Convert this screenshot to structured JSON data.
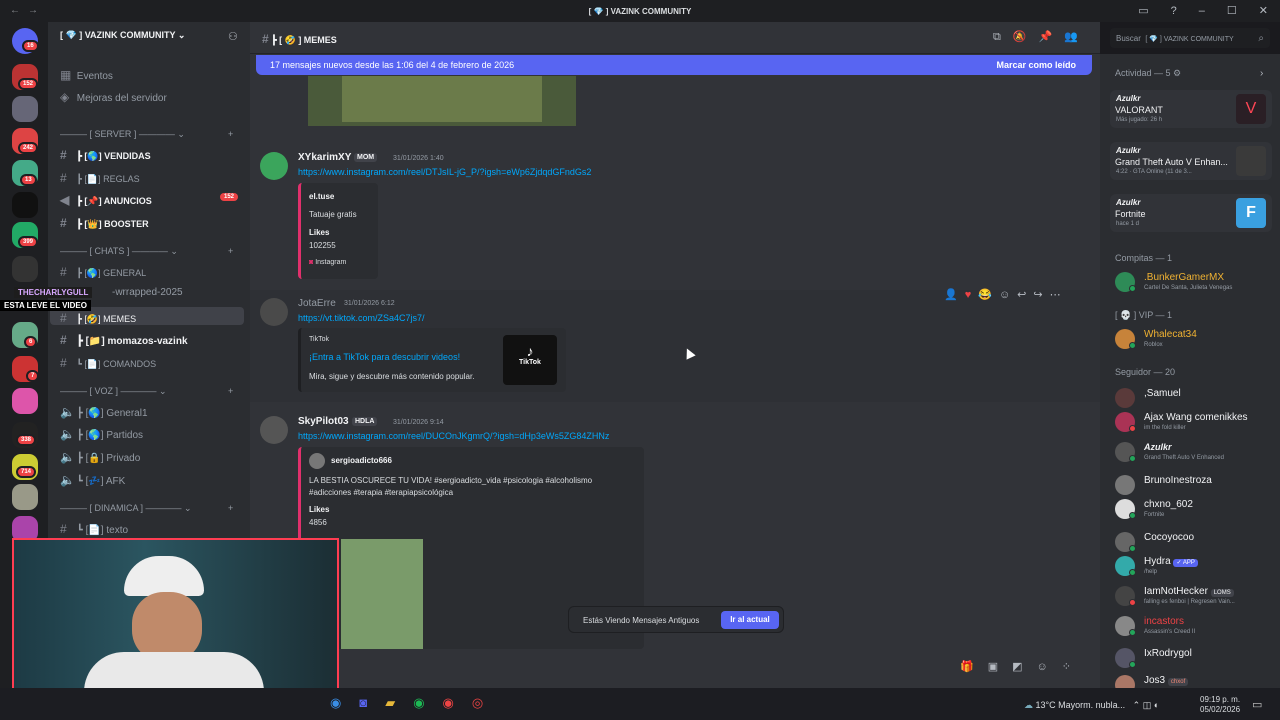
{
  "window": {
    "title": "[ 💎 ] VAZINK COMMUNITY",
    "nav_back": "←",
    "nav_forward": "→"
  },
  "server": {
    "name": "[ 💎 ] VAZINK COMMUNITY",
    "top_items": [
      "Eventos",
      "Mejoras del servidor"
    ],
    "categories": [
      {
        "label": "[ SERVER ]",
        "channels": [
          {
            "name": "VENDIDAS",
            "prefix": "[🌎]",
            "bold": true
          },
          {
            "name": "REGLAS",
            "prefix": "[📄]",
            "bold": false
          },
          {
            "name": "ANUNCIOS",
            "prefix": "[📌]",
            "bold": true,
            "count": "152"
          },
          {
            "name": "BOOSTER",
            "prefix": "[👑]",
            "bold": true
          }
        ]
      },
      {
        "label": "[ CHATS ]",
        "channels": [
          {
            "name": "GENERAL",
            "prefix": "[🌎]",
            "bold": false
          },
          {
            "name": "-wrrapped-2025",
            "prefix": "",
            "bold": false
          },
          {
            "name": "MEMES",
            "prefix": "[🤣]",
            "bold": false
          },
          {
            "name": "momazos-vazink",
            "prefix": "[📁]",
            "bold": true
          },
          {
            "name": "COMANDOS",
            "prefix": "[📄]",
            "bold": false
          }
        ]
      },
      {
        "label": "[ VOZ ]",
        "channels": [
          {
            "name": "General1",
            "prefix": "[🌎]"
          },
          {
            "name": "Partidos",
            "prefix": "[🌎]"
          },
          {
            "name": "Privado",
            "prefix": "[🔒]"
          },
          {
            "name": "AFK",
            "prefix": "[💤]"
          }
        ]
      },
      {
        "label": "[ DINAMICA ]",
        "channels": [
          {
            "name": "texto",
            "prefix": "[📄]"
          }
        ]
      }
    ]
  },
  "rail_badges": [
    "16",
    "152",
    "242",
    "13",
    "399",
    "6",
    "7",
    "338",
    "714"
  ],
  "overlay": {
    "user": "THECHARLYGULL",
    "caption": "ESTA LEVE EL VIDEO"
  },
  "channel": {
    "title": "[ 🤣 ] MEMES"
  },
  "new_messages": {
    "text": "17 mensajes nuevos desde las 1:06 del 4 de febrero de 2026",
    "action": "Marcar como leído"
  },
  "messages": [
    {
      "user": "XYkarimXY",
      "tag": "MOM",
      "time": "31/01/2026 1:40",
      "link": "https://www.instagram.com/reel/DTJsIL-jG_P/?igsh=eWp6ZjdqdGFndGs2",
      "embed": {
        "author": "el.tuse",
        "desc": "Tatuaje gratis",
        "field": "Likes",
        "value": "102255",
        "footer": "Instagram"
      }
    },
    {
      "user": "JotaErre",
      "time": "31/01/2026 6:12",
      "link": "https://vt.tiktok.com/ZSa4C7js7/",
      "embed": {
        "provider": "TikTok",
        "title": "¡Entra a TikTok para descubrir videos!",
        "desc": "Mira, sigue y descubre más contenido popular.",
        "thumb": "TikTok"
      }
    },
    {
      "user": "SkyPilot03",
      "tag": "HDLA",
      "time": "31/01/2026 9:14",
      "link": "https://www.instagram.com/reel/DUCOnJKgmrQ/?igsh=dHp3eWs5ZG84ZHNz",
      "embed": {
        "author": "sergioadicto666",
        "desc1": "LA BESTIA OSCURECE TU VIDA! #sergioadicto_vida #psicologia #alcoholismo",
        "desc2": "#adicciones #terapia #terapiapsicológica",
        "field": "Likes",
        "value": "4856"
      }
    }
  ],
  "old_messages": {
    "text": "Estás Viendo Mensajes Antiguos",
    "button": "Ir al actual"
  },
  "search": {
    "placeholder": "Buscar",
    "scope": "[ 💎 ] VAZINK COMMUNITY"
  },
  "activity": {
    "header": "Actividad — 5",
    "cards": [
      {
        "user": "Azulkr",
        "game": "VALORANT",
        "detail": "Más jugado: 26 h",
        "color": "#2a1f25"
      },
      {
        "user": "Azulkr",
        "game": "Grand Theft Auto V Enhan...",
        "detail": "4:22 · GTA Online (11 de 3...",
        "color": "#3a3a3a"
      },
      {
        "user": "Azulkr",
        "game": "Fortnite",
        "detail": "hace 1 d",
        "color": "#3aa0e0"
      }
    ]
  },
  "groups": [
    {
      "label": "Compitas — 1",
      "members": [
        {
          "name": ".BunkerGamerMX",
          "status": "Cartel De Santa, Julieta Venegas",
          "color": "#f0b232",
          "av": "#2e8b57"
        }
      ]
    },
    {
      "label": "[ 💀 ] VIP — 1",
      "members": [
        {
          "name": "Whalecat34",
          "status": "Roblox",
          "color": "#f0b232",
          "av": "#c7833a"
        }
      ]
    },
    {
      "label": "Seguidor — 20",
      "members": [
        {
          "name": ",Samuel",
          "status": "",
          "color": "#f2f3f5",
          "av": "#5a3a3a"
        },
        {
          "name": "Ajax Wang comenikkes",
          "status": "im the fold killer",
          "color": "#f2f3f5",
          "av": "#a35"
        },
        {
          "name": "Azulkr",
          "status": "Grand Theft Auto V Enhanced",
          "color": "#f2f3f5",
          "av": "#555"
        },
        {
          "name": "BrunoInestroza",
          "status": "",
          "color": "#f2f3f5",
          "av": "#777"
        },
        {
          "name": "chxno_602",
          "status": "Fortnite",
          "color": "#f2f3f5",
          "av": "#ddd"
        },
        {
          "name": "Cocoyocoo",
          "status": "",
          "color": "#f2f3f5",
          "av": "#666"
        },
        {
          "name": "Hydra",
          "badge": "✓ APP",
          "status": "/help",
          "color": "#f2f3f5",
          "av": "#3aa"
        },
        {
          "name": "IamNotHecker",
          "badge": "LOMS",
          "status": "falling es fenboi | Regresen Vain...",
          "color": "#f2f3f5",
          "av": "#444"
        },
        {
          "name": "incastors",
          "status": "Assassin's Creed II",
          "color": "#ed4245",
          "av": "#888"
        },
        {
          "name": "IxRodrygol",
          "status": "",
          "color": "#f2f3f5",
          "av": "#556"
        },
        {
          "name": "Jos3",
          "badge": "chxof",
          "status": "",
          "color": "#f2f3f5",
          "av": "#a76"
        }
      ]
    }
  ],
  "taskbar": {
    "weather": "13°C  Mayorm. nubla...",
    "time": "09:19 p. m.",
    "date": "05/02/2026"
  }
}
